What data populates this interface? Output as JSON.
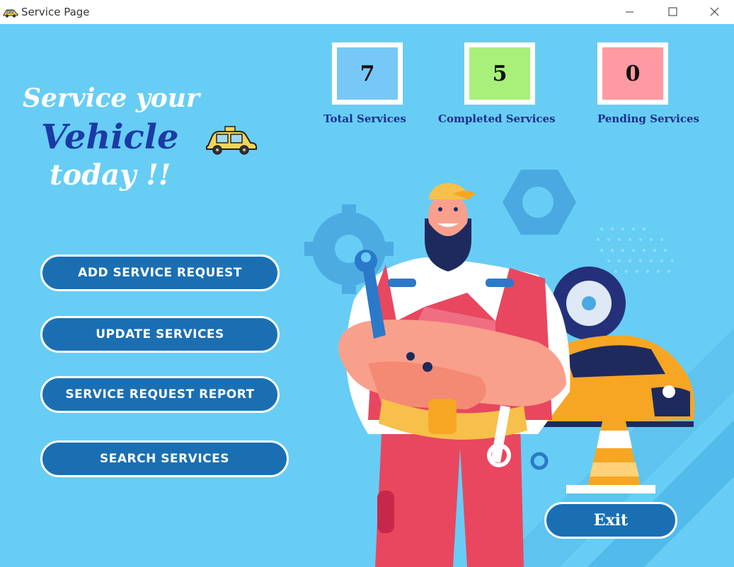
{
  "window": {
    "title": "Service Page",
    "icon": "car-icon"
  },
  "headline": {
    "line1": "Service your",
    "line2": "Vehicle",
    "line3": "today !!"
  },
  "stats": [
    {
      "value": "7",
      "label": "Total Services",
      "color": "#77c8f7"
    },
    {
      "value": "5",
      "label": "Completed Services",
      "color": "#a8f07a"
    },
    {
      "value": "0",
      "label": "Pending Services",
      "color": "#ff9aa2"
    }
  ],
  "buttons": {
    "add": "ADD SERVICE REQUEST",
    "update": "UPDATE SERVICES",
    "report": "SERVICE REQUEST REPORT",
    "search": "SEARCH SERVICES",
    "exit": "Exit"
  },
  "colors": {
    "background": "#67cdf5",
    "button": "#1a6fb3",
    "headline_blue": "#1b3aa6",
    "label": "#1c2e8c"
  }
}
